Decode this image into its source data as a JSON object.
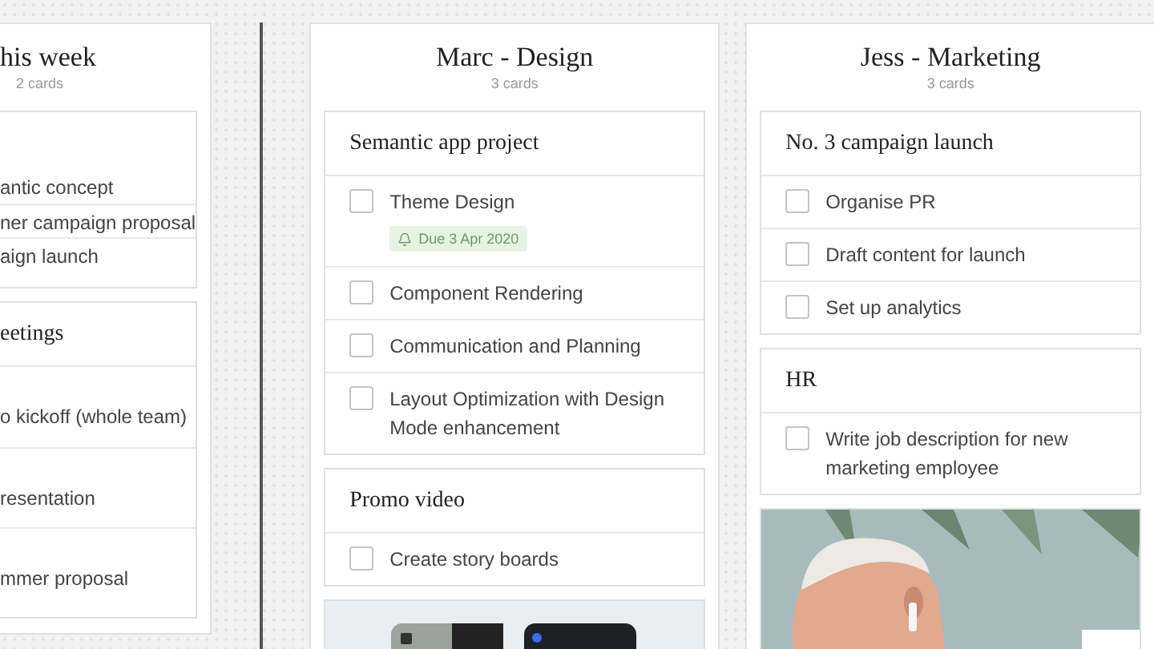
{
  "columns": [
    {
      "kind": "partial",
      "title": "his week",
      "count": "2 cards",
      "cards": [
        {
          "kind": "tasks",
          "tasks": [
            {
              "text": "antic concept"
            },
            {
              "text": "ner campaign proposal"
            },
            {
              "text": "aign launch"
            }
          ]
        },
        {
          "kind": "tasks",
          "title": "eetings",
          "tasks": [
            {
              "text": "o kickoff (whole team)"
            },
            {
              "text": "resentation"
            },
            {
              "text": "mmer proposal"
            }
          ]
        }
      ]
    },
    {
      "kind": "full",
      "title": "Marc - Design",
      "count": "3 cards",
      "cards": [
        {
          "kind": "tasks",
          "title": "Semantic app project",
          "tasks": [
            {
              "text": "Theme Design",
              "checked": false,
              "due": "Due 3 Apr 2020"
            },
            {
              "text": "Component Rendering",
              "checked": false
            },
            {
              "text": "Communication and Planning",
              "checked": false
            },
            {
              "text": "Layout Optimization with Design Mode enhancement",
              "checked": false
            }
          ]
        },
        {
          "kind": "tasks",
          "title": "Promo video",
          "tasks": [
            {
              "text": "Create story boards",
              "checked": false
            }
          ]
        },
        {
          "kind": "picture"
        }
      ]
    },
    {
      "kind": "full",
      "title": "Jess - Marketing",
      "count": "3 cards",
      "cards": [
        {
          "kind": "tasks",
          "title": "No. 3 campaign launch",
          "tasks": [
            {
              "text": "Organise PR",
              "checked": false
            },
            {
              "text": "Draft content for launch",
              "checked": false
            },
            {
              "text": "Set up analytics",
              "checked": false
            }
          ]
        },
        {
          "kind": "tasks",
          "title": "HR",
          "tasks": [
            {
              "text": "Write job description for new marketing employee",
              "checked": false
            }
          ]
        },
        {
          "kind": "picture"
        }
      ]
    }
  ]
}
